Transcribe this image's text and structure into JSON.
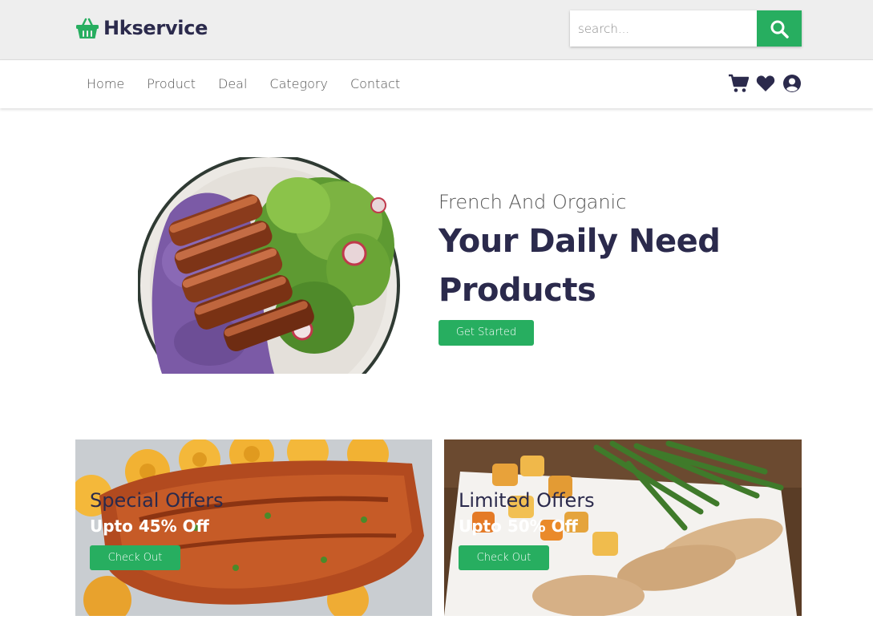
{
  "header": {
    "brand": "Hkservice",
    "logo_icon": "basket-icon",
    "search": {
      "placeholder": "search...",
      "value": "",
      "button_icon": "search-icon"
    }
  },
  "nav": {
    "links": [
      "Home",
      "Product",
      "Deal",
      "Category",
      "Contact"
    ],
    "icons": [
      "cart-icon",
      "heart-icon",
      "user-icon"
    ]
  },
  "hero": {
    "subtitle": "French And Organic",
    "title": "Your Daily Need Products",
    "button": "Get Started"
  },
  "offers": [
    {
      "title": "Special Offers",
      "subtitle": "Upto 45% Off",
      "button": "Check Out"
    },
    {
      "title": "Limited Offers",
      "subtitle": "Upto 50% Off",
      "button": "Check Out"
    }
  ],
  "colors": {
    "accent": "#27ae60",
    "text": "#2b2a4c",
    "topbar": "#eeeeee"
  }
}
